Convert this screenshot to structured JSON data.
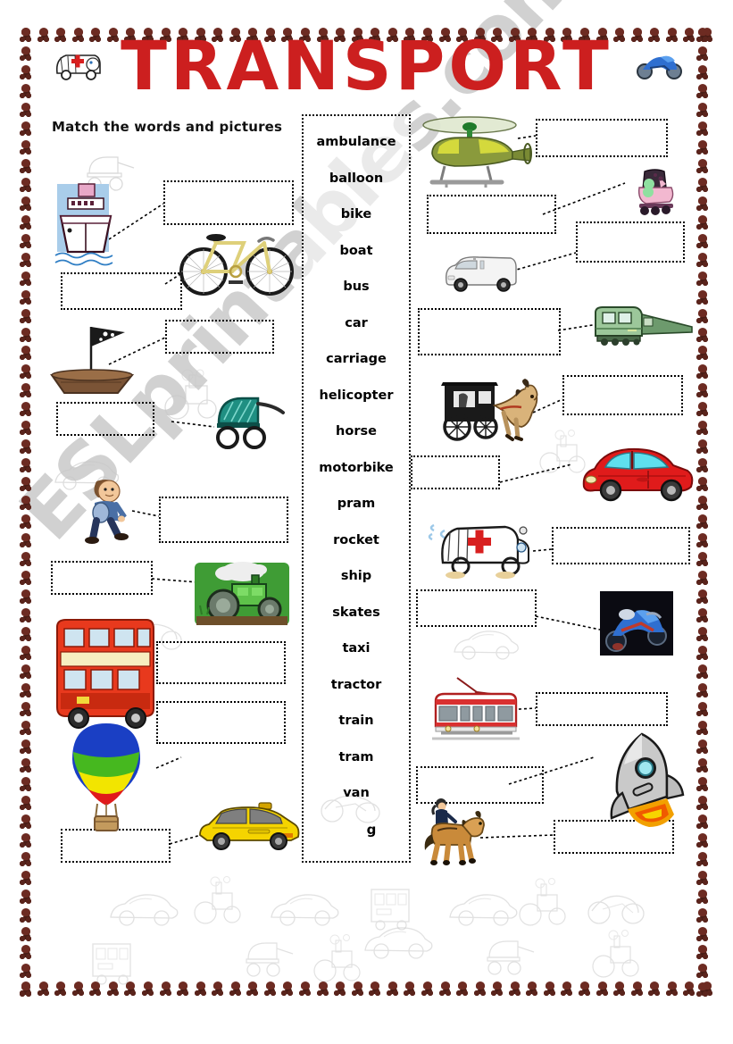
{
  "page": {
    "title": "TRANSPORT",
    "instruction": "Match the words and pictures",
    "watermark": "ESLprintables.com",
    "title_color": "#cc1f1f",
    "border_icon": "motorbike-icon"
  },
  "wordlist": {
    "words": [
      "ambulance",
      "balloon",
      "bike",
      "boat",
      "bus",
      "car",
      "carriage",
      "helicopter",
      "horse",
      "motorbike",
      "pram",
      "rocket",
      "ship",
      "skates",
      "taxi",
      "tractor",
      "train",
      "tram",
      "van",
      "g"
    ]
  },
  "pictures": {
    "left": [
      {
        "name": "ship",
        "label": "cruise-ship"
      },
      {
        "name": "bike",
        "label": "bicycle"
      },
      {
        "name": "boat",
        "label": "wooden-boat-pirate-flag"
      },
      {
        "name": "pram",
        "label": "baby-pram"
      },
      {
        "name": "walking-boy",
        "label": "boy-walking"
      },
      {
        "name": "tractor",
        "label": "green-tractor"
      },
      {
        "name": "bus",
        "label": "red-double-decker-bus"
      },
      {
        "name": "balloon",
        "label": "hot-air-balloon"
      },
      {
        "name": "taxi",
        "label": "yellow-taxi"
      }
    ],
    "right": [
      {
        "name": "helicopter",
        "label": "helicopter"
      },
      {
        "name": "skates",
        "label": "roller-skate"
      },
      {
        "name": "van",
        "label": "white-van"
      },
      {
        "name": "train",
        "label": "green-train"
      },
      {
        "name": "carriage",
        "label": "horse-drawn-carriage"
      },
      {
        "name": "car",
        "label": "red-car"
      },
      {
        "name": "ambulance",
        "label": "ambulance"
      },
      {
        "name": "motorbike",
        "label": "blue-motorbike"
      },
      {
        "name": "tram",
        "label": "red-tram"
      },
      {
        "name": "rocket",
        "label": "rocket"
      },
      {
        "name": "horse",
        "label": "horse-with-rider"
      }
    ]
  },
  "colors": {
    "title_red": "#cc1f1f",
    "bus_red": "#e8391d",
    "taxi_yellow": "#f5d400",
    "car_red": "#e01b1b",
    "tram_red": "#d93030",
    "tractor_green": "#3f9c35",
    "pram_teal": "#1f8f82",
    "bike_yellow": "#ded07a",
    "balloon_blue": "#1a3fc4",
    "balloon_green": "#46b81f",
    "balloon_yellow": "#f2e500",
    "watermark_grey": "#c9c9c9",
    "border_maroon": "#6d2b22"
  },
  "answer_boxes": {
    "count": 20,
    "style": "dotted-outline-empty"
  }
}
